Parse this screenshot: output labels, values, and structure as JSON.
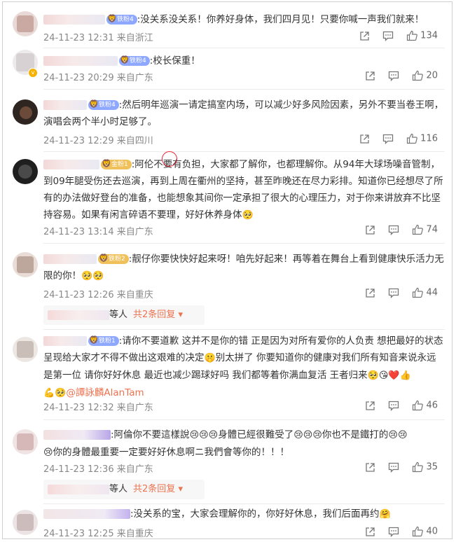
{
  "comments": [
    {
      "badge": "铁粉4",
      "text": ":没关系没关系！你养好身体，我们四月见！只要你喊一声我们就来！",
      "time": "24-11-23 12:31 来自浙江",
      "likes": "134"
    },
    {
      "badge": "铁粉4",
      "text": ":校长保重！",
      "time": "24-11-23 20:29 来自广东",
      "likes": "20"
    },
    {
      "badge": "铁粉4",
      "text": ":然后明年巡演一请定搞室内场，可以减少好多风险因素，另外不要当卷王啊，演唱会两个半小时足够了。",
      "time": "24-11-23 12:29 来自四川",
      "likes": "116"
    },
    {
      "badge": "金粉1",
      "text": ":阿伦不要有负担，大家都了解你，也都理解你。从94年大球场噪音管制，到09年腿受伤还去巡演，再到上周在衢州的坚持，甚至昨晚还在尽力彩排。知道你已经想尽了所有的办法做好登台的准备，也能想象其间你一定承担了很大的心理压力，对于你来讲放弃不比坚持容易。如果有闲言碎语不要理，好好休养身体",
      "emoji": "🥺",
      "time": "24-11-23 13:14 来自广东",
      "likes": "74"
    },
    {
      "badge": "铁粉2",
      "text": ":靓仔你要快快好起来呀！咱先好起来！再等着在舞台上看到健康快乐活力无限的你！",
      "emoji": "🥺🥺",
      "time": "24-11-23 12:26 来自重庆",
      "likes": "44",
      "reply_people": "等人",
      "reply_more": "共2条回复",
      "reply_arrow": "▾"
    },
    {
      "badge": "铁粉1",
      "text": ":请你不要道歉 这并不是你的错  正是因为对所有爱你的人负责 想把最好的状态呈现给大家才不得不做出这艰难的决定",
      "text_2": "别太拼了 你要知道你的健康对我们所有知音来说永远是第一位 请你好好休息 最近也减少踢球好吗 我们都等着你满血复活 王者归来",
      "emoji_mid": "🤫",
      "emoji_end": "🥺😘❤️👍",
      "emoji_line3": "💪🥺",
      "mention": "@譚詠麟AlanTam",
      "time": "24-11-23 12:32 来自广东",
      "likes": "46"
    },
    {
      "text": ":阿倫你不要這樣說",
      "seg2": "身體已經很難受了",
      "seg3": "你也不是鐵打的",
      "seg4": "你的身體最重要一定要好好休息啊ニ我們會等你的！！！",
      "emoji_cry2": "😢😢",
      "emoji_cry3": "😢😢😢",
      "emoji_cry1": "😢",
      "time": "24-11-23 12:36 来自广东",
      "likes": "35",
      "reply_people": "等人",
      "reply_more": "共2条回复",
      "reply_arrow": "▾"
    },
    {
      "text": ":没关系的宝，大家会理解你的，你好好休息，我们后面再约",
      "emoji": "🤗",
      "time": "24-11-23 12:25 来自重庆",
      "likes": "40"
    }
  ]
}
